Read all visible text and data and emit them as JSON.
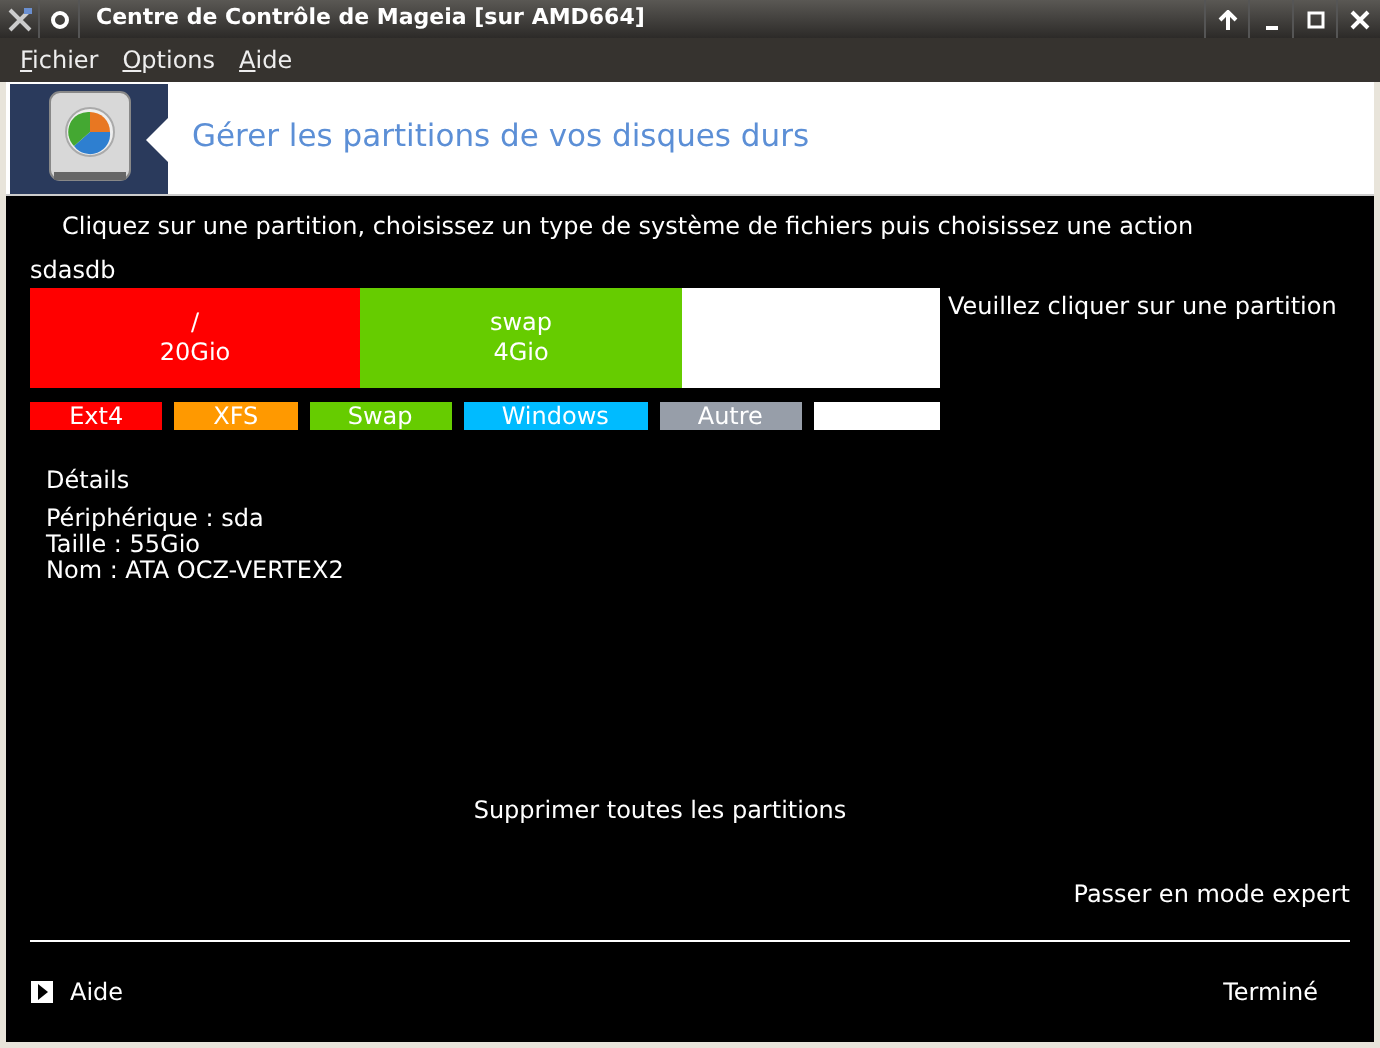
{
  "window": {
    "title": "Centre de Contrôle de Mageia  [sur AMD664]"
  },
  "menu": [
    "Fichier",
    "Options",
    "Aide"
  ],
  "header": {
    "title": "Gérer les partitions de vos disques durs"
  },
  "instruction": "Cliquez sur une partition, choisissez un type de système de fichiers puis choisissez une action",
  "disk_tabs": "sdasdb",
  "partitions": [
    {
      "mount": "/",
      "size": "20Gio",
      "color": "#ff0000"
    },
    {
      "mount": "swap",
      "size": "4Gio",
      "color": "#66cc00"
    },
    {
      "color": "#ffffff"
    }
  ],
  "hint": "Veuillez cliquer sur une partition",
  "legend": [
    {
      "label": "Ext4",
      "color": "#ff0000"
    },
    {
      "label": "XFS",
      "color": "#ff9900"
    },
    {
      "label": "Swap",
      "color": "#66cc00"
    },
    {
      "label": "Windows",
      "color": "#00bbff"
    },
    {
      "label": "Autre",
      "color": "#979ea9"
    },
    {
      "color": "#ffffff"
    }
  ],
  "details": {
    "title": "Détails",
    "lines": [
      "Périphérique : sda",
      "Taille : 55Gio",
      "Nom : ATA OCZ-VERTEX2"
    ]
  },
  "actions": {
    "clear_all": "Supprimer toutes les partitions",
    "expert": "Passer en mode expert"
  },
  "footer": {
    "help": "Aide",
    "done": "Terminé"
  }
}
